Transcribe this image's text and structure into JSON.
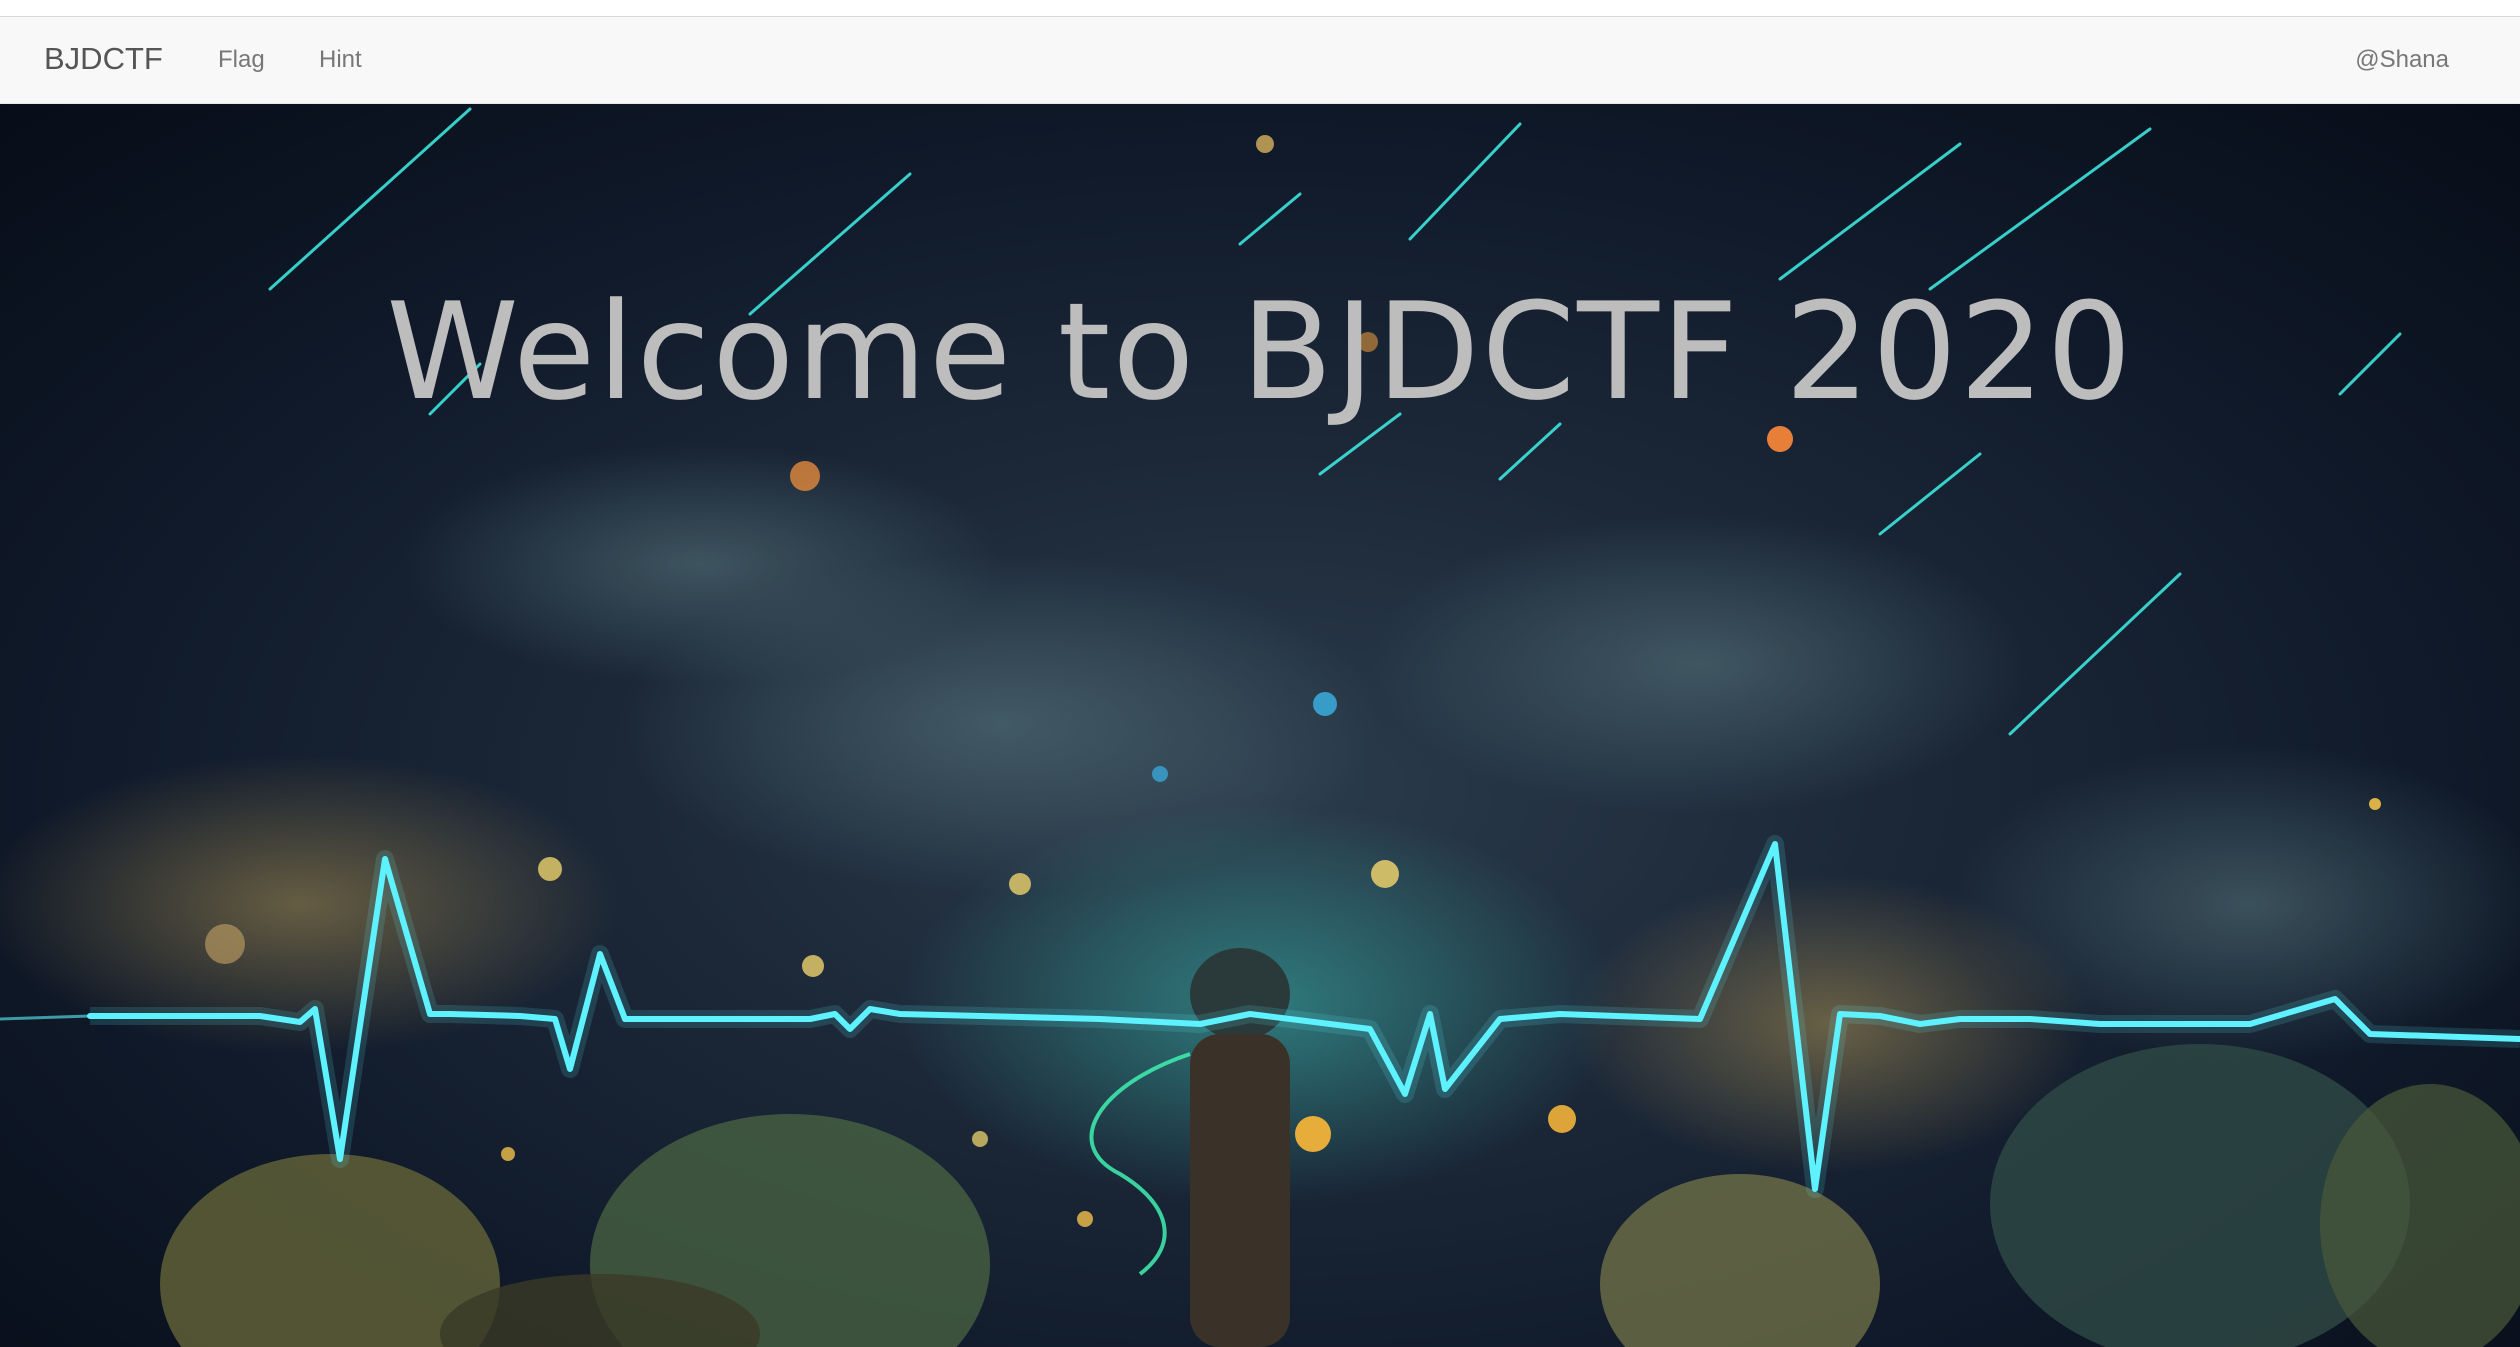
{
  "navbar": {
    "brand": "BJDCTF",
    "links": [
      {
        "label": "Flag"
      },
      {
        "label": "Hint"
      }
    ],
    "user": "@Shana"
  },
  "hero": {
    "title": "Welcome to BJDCTF 2020",
    "background": "night-sky-heartbeat-illustration"
  },
  "colors": {
    "navbar_bg": "#f8f8f8",
    "nav_text": "#777777",
    "brand_text": "#555555",
    "title_text": "#bdbdbd",
    "heartbeat": "#5ef2ff",
    "sky": "#101a2a"
  }
}
